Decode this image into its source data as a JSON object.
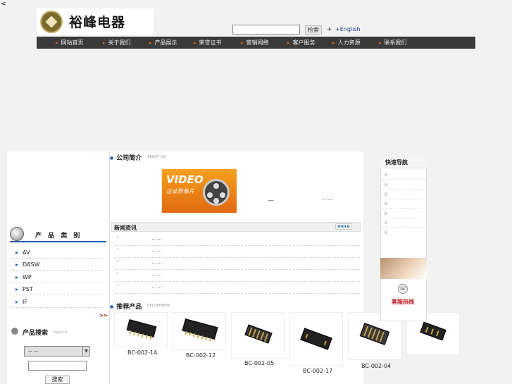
{
  "stray_char": "<",
  "header": {
    "logo_text": "裕峰电器",
    "search_button": "检索",
    "plus": "+",
    "english_link": "+English"
  },
  "nav": [
    "网站首页",
    "关于我们",
    "产品展示",
    "荣誉证书",
    "营销网络",
    "客户服务",
    "人力资源",
    "联系我们"
  ],
  "sidebar": {
    "category_title": "产 品 类 别",
    "categories": [
      "AV",
      "DASW",
      "WP",
      "PST",
      "IF"
    ],
    "more": ">>",
    "product_search_title": "产品搜索",
    "product_search_sub": "Search",
    "select_value": "--      --",
    "search_button": "搜索"
  },
  "about": {
    "title": "公司简介",
    "sub": "ABOUT US",
    "video_title": "VIDEO",
    "video_sub": "企业形象片",
    "dash": "—",
    "ellipsis": "......"
  },
  "news": {
    "title": "新闻资讯",
    "more": "more",
    "items": [
      "......",
      "......",
      "......",
      "......",
      "......"
    ]
  },
  "products": {
    "title": "推荐产品",
    "sub": "RECOMMEND",
    "items": [
      {
        "label": "BC-002-14"
      },
      {
        "label": "BC-002-12"
      },
      {
        "label": "BC-002-05"
      },
      {
        "label": "BC-002-17"
      },
      {
        "label": "BC-002-04"
      },
      {
        "label": ""
      }
    ]
  },
  "quick_nav": {
    "title": "快速导航",
    "items": [
      "B",
      "B",
      "B",
      "B",
      "B",
      "B",
      "B"
    ],
    "hotline": "客服热线"
  },
  "colors": {
    "nav_bg": "#3a3a3a",
    "accent_blue": "#2a5aa8",
    "accent_red": "#c0151c",
    "video_orange": "#f6a020"
  }
}
